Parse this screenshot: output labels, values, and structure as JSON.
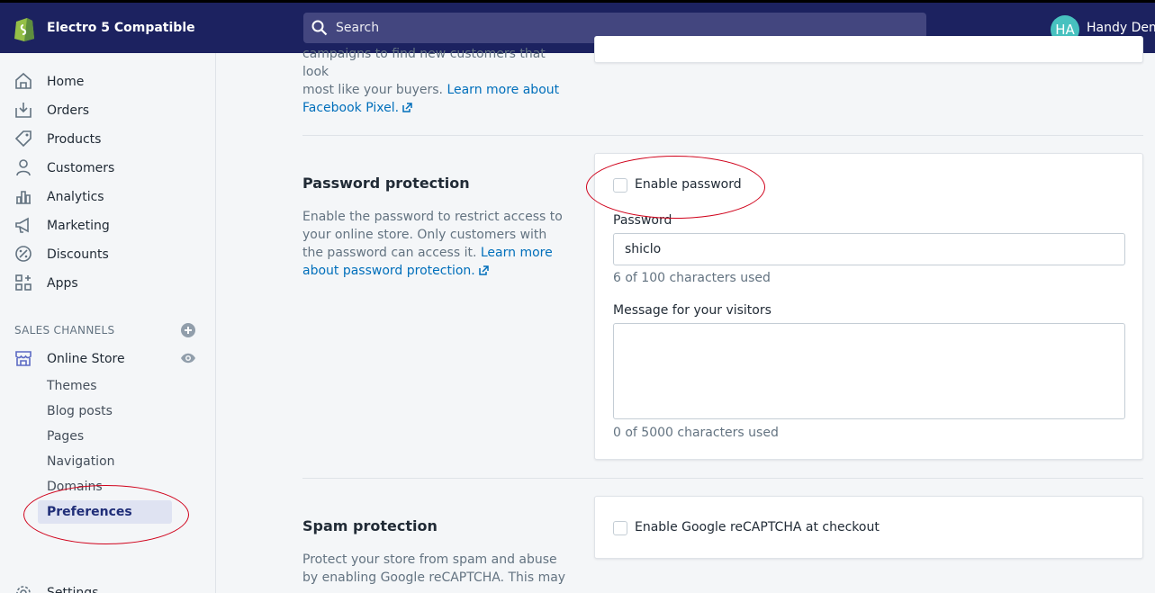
{
  "topbar": {
    "store_name": "Electro 5 Compatible",
    "search_placeholder": "Search",
    "avatar_initials": "HA",
    "user_name": "Handy Dem"
  },
  "sidebar": {
    "items": [
      {
        "label": "Home",
        "icon": "home-icon"
      },
      {
        "label": "Orders",
        "icon": "orders-icon"
      },
      {
        "label": "Products",
        "icon": "tag-icon"
      },
      {
        "label": "Customers",
        "icon": "person-icon"
      },
      {
        "label": "Analytics",
        "icon": "bar-chart-icon"
      },
      {
        "label": "Marketing",
        "icon": "megaphone-icon"
      },
      {
        "label": "Discounts",
        "icon": "discount-icon"
      },
      {
        "label": "Apps",
        "icon": "apps-icon"
      }
    ],
    "sales_channels_title": "SALES CHANNELS",
    "online_store": "Online Store",
    "sub_items": [
      "Themes",
      "Blog posts",
      "Pages",
      "Navigation",
      "Domains"
    ],
    "active_sub_item": "Preferences",
    "settings": "Settings"
  },
  "facebook_section": {
    "desc_line1": "campaigns to find new customers that look",
    "desc_line2": "most like your buyers. ",
    "link_part1": "Learn more about",
    "link_part2": "Facebook Pixel."
  },
  "password_section": {
    "heading": "Password protection",
    "desc": "Enable the password to restrict access to your online store. Only customers with the password can access it. ",
    "link": "Learn more about password protection.",
    "enable_label": "Enable password",
    "password_label": "Password",
    "password_value": "shiclo",
    "password_help": "6 of 100 characters used",
    "message_label": "Message for your visitors",
    "message_value": "",
    "message_help": "0 of 5000 characters used"
  },
  "spam_section": {
    "heading": "Spam protection",
    "desc": "Protect your store from spam and abuse by enabling Google reCAPTCHA. This may",
    "recaptcha_label": "Enable Google reCAPTCHA at checkout"
  },
  "colors": {
    "topbar": "#1c2260",
    "link": "#006fbb",
    "annotation": "#d0021b"
  }
}
